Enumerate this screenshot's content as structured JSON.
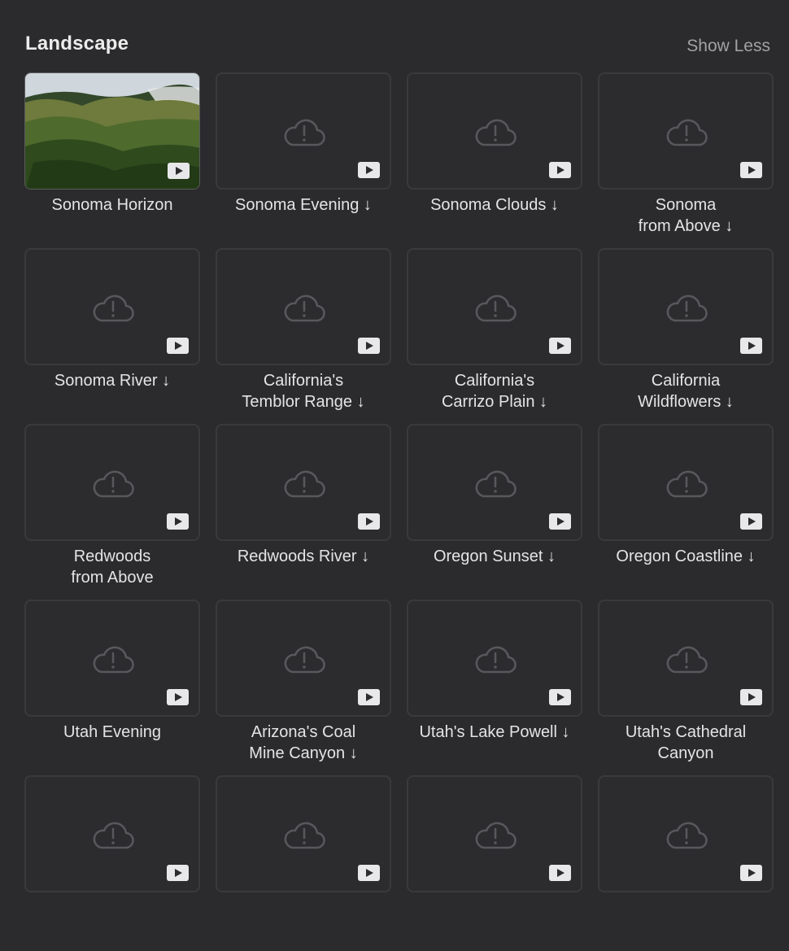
{
  "section": {
    "title": "Landscape",
    "toggle_label": "Show Less"
  },
  "icons": {
    "placeholder": "cloud-exclamation-icon",
    "video": "play-video-icon"
  },
  "tiles": [
    {
      "label": "Sonoma Horizon",
      "thumbnail": "image"
    },
    {
      "label": "Sonoma Evening ↓",
      "thumbnail": "placeholder"
    },
    {
      "label": "Sonoma Clouds ↓",
      "thumbnail": "placeholder"
    },
    {
      "label": "Sonoma\nfrom Above ↓",
      "thumbnail": "placeholder"
    },
    {
      "label": "Sonoma River ↓",
      "thumbnail": "placeholder"
    },
    {
      "label": "California's\nTemblor Range ↓",
      "thumbnail": "placeholder"
    },
    {
      "label": "California's\nCarrizo Plain ↓",
      "thumbnail": "placeholder"
    },
    {
      "label": "California\nWildflowers ↓",
      "thumbnail": "placeholder"
    },
    {
      "label": "Redwoods\nfrom Above",
      "thumbnail": "placeholder"
    },
    {
      "label": "Redwoods River ↓",
      "thumbnail": "placeholder"
    },
    {
      "label": "Oregon Sunset ↓",
      "thumbnail": "placeholder"
    },
    {
      "label": "Oregon Coastline ↓",
      "thumbnail": "placeholder"
    },
    {
      "label": "Utah Evening",
      "thumbnail": "placeholder"
    },
    {
      "label": "Arizona's Coal\nMine Canyon ↓",
      "thumbnail": "placeholder"
    },
    {
      "label": "Utah's Lake Powell ↓",
      "thumbnail": "placeholder"
    },
    {
      "label": "Utah's Cathedral\nCanyon",
      "thumbnail": "placeholder"
    },
    {
      "label": "",
      "thumbnail": "placeholder"
    },
    {
      "label": "",
      "thumbnail": "placeholder"
    },
    {
      "label": "",
      "thumbnail": "placeholder"
    },
    {
      "label": "",
      "thumbnail": "placeholder"
    }
  ]
}
